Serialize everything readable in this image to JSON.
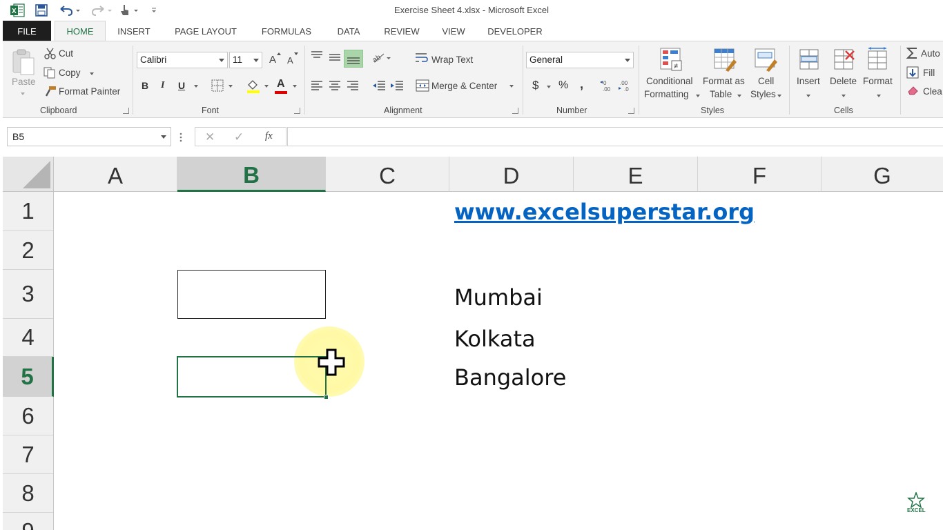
{
  "window": {
    "title": "Exercise Sheet 4.xlsx - Microsoft Excel"
  },
  "tabs": {
    "file": "FILE",
    "items": [
      "HOME",
      "INSERT",
      "PAGE LAYOUT",
      "FORMULAS",
      "DATA",
      "REVIEW",
      "VIEW",
      "DEVELOPER"
    ],
    "active": "HOME"
  },
  "ribbon": {
    "clipboard": {
      "paste": "Paste",
      "cut": "Cut",
      "copy": "Copy",
      "format_painter": "Format Painter",
      "label": "Clipboard"
    },
    "font": {
      "name": "Calibri",
      "size": "11",
      "grow": "A",
      "shrink": "A",
      "bold": "B",
      "italic": "I",
      "underline": "U",
      "font_color_letter": "A",
      "label": "Font"
    },
    "alignment": {
      "wrap_text": "Wrap Text",
      "merge_center": "Merge & Center",
      "label": "Alignment"
    },
    "number": {
      "format": "General",
      "currency": "$",
      "percent": "%",
      "comma": ",",
      "label": "Number"
    },
    "styles": {
      "conditional_1": "Conditional",
      "conditional_2": "Formatting",
      "format_table_1": "Format as",
      "format_table_2": "Table",
      "cell_styles_1": "Cell",
      "cell_styles_2": "Styles",
      "label": "Styles"
    },
    "cells": {
      "insert": "Insert",
      "delete": "Delete",
      "format": "Format",
      "label": "Cells"
    },
    "editing": {
      "autosum": "Auto",
      "fill": "Fill",
      "clear": "Clea"
    }
  },
  "formula_bar": {
    "name_box": "B5",
    "cancel": "✕",
    "enter": "✓",
    "fx": "fx",
    "formula": ""
  },
  "sheet": {
    "columns": [
      "A",
      "B",
      "C",
      "D",
      "E",
      "F",
      "G"
    ],
    "rows": [
      "1",
      "2",
      "3",
      "4",
      "5",
      "6",
      "7",
      "8",
      "9"
    ],
    "selected_column": "B",
    "selected_row": "5",
    "cells": {
      "D1": "www.excelsuperstar.org",
      "D3": "Mumbai",
      "D4": "Kolkata",
      "D5": "Bangalore"
    },
    "active_cell": "B5"
  },
  "watermark": {
    "line1": "EXCEL"
  },
  "colors": {
    "excel_green": "#217346",
    "link_blue": "#0563c1"
  }
}
